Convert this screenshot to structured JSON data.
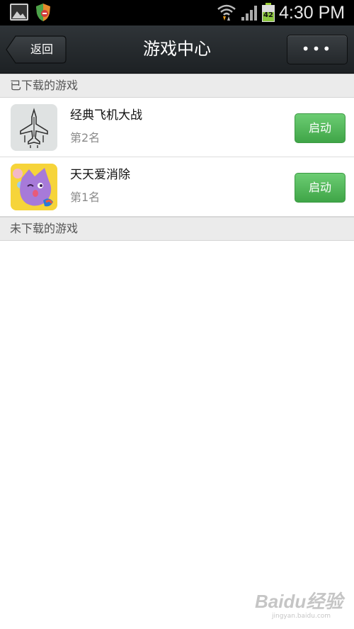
{
  "status_bar": {
    "time": "4:30 PM",
    "battery_level": "42",
    "icons": [
      "gallery-icon",
      "shield-icon",
      "wifi-icon",
      "signal-icon",
      "battery-icon"
    ]
  },
  "header": {
    "back_label": "返回",
    "title": "游戏中心",
    "more_label": "•••"
  },
  "sections": {
    "downloaded": "已下载的游戏",
    "not_downloaded": "未下载的游戏"
  },
  "games": [
    {
      "name": "经典飞机大战",
      "rank": "第2名",
      "action": "启动",
      "icon": "airplane-game-icon"
    },
    {
      "name": "天天爱消除",
      "rank": "第1名",
      "action": "启动",
      "icon": "cat-game-icon"
    }
  ],
  "watermark": {
    "brand": "Baidu经验",
    "url": "jingyan.baidu.com"
  },
  "colors": {
    "header_bg": "#24282b",
    "launch_button": "#4cb454",
    "section_bg": "#ebebeb"
  }
}
